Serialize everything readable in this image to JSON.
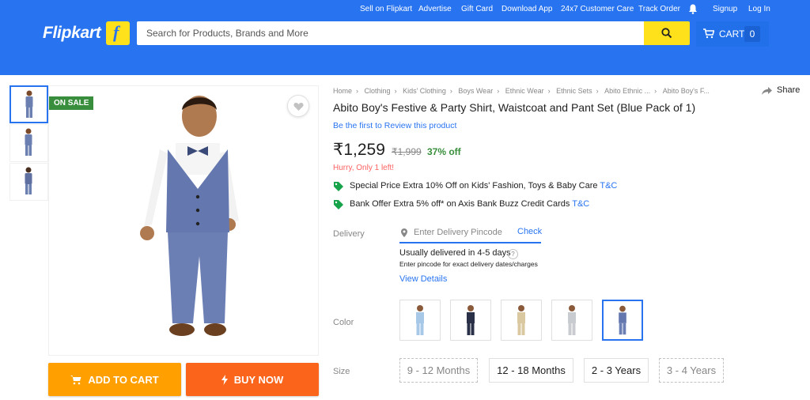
{
  "header": {
    "links": [
      "Sell on Flipkart",
      "Advertise",
      "Gift Card",
      "Download App",
      "24x7 Customer Care",
      "Track Order",
      "Signup",
      "Log In"
    ],
    "logo": "Flipkart",
    "search_placeholder": "Search for Products, Brands and More",
    "cart_label": "CART",
    "cart_count": "0",
    "accent": "#2874f0",
    "search_button_color": "#ffe11b"
  },
  "gallery": {
    "badge": "ON SALE",
    "thumbnails": 3,
    "active_thumbnail": 1
  },
  "actions": {
    "add_to_cart": "ADD TO CART",
    "buy_now": "BUY NOW",
    "add_to_cart_color": "#ff9f00",
    "buy_now_color": "#fb641b"
  },
  "product": {
    "breadcrumbs": [
      "Home",
      "Clothing",
      "Kids' Clothing",
      "Boys Wear",
      "Ethnic Wear",
      "Ethnic Sets",
      "Abito Ethnic ...",
      "Abito Boy's F..."
    ],
    "share": "Share",
    "title": "Abito Boy's Festive & Party Shirt, Waistcoat and Pant Set  (Blue Pack of 1)",
    "review_link": "Be the first to Review this product",
    "price": "₹1,259",
    "mrp": "₹1,999",
    "discount": "37% off",
    "stock_note": "Hurry, Only 1 left!",
    "offers": [
      {
        "text": "Special Price Extra 10% Off on Kids' Fashion, Toys & Baby Care",
        "tc": "T&C"
      },
      {
        "text": "Bank Offer Extra 5% off* on Axis Bank Buzz Credit Cards",
        "tc": "T&C"
      }
    ]
  },
  "delivery": {
    "label": "Delivery",
    "pincode_placeholder": "Enter Delivery Pincode",
    "check": "Check",
    "eta": "Usually delivered in 4-5 days",
    "note": "Enter pincode for exact delivery dates/charges",
    "view_details": "View Details",
    "help": "?"
  },
  "color": {
    "label": "Color",
    "swatches": [
      "light-blue",
      "navy",
      "beige",
      "grey",
      "blue"
    ],
    "selected": 4
  },
  "size": {
    "label": "Size",
    "options": [
      {
        "label": "9 - 12 Months",
        "available": false
      },
      {
        "label": "12 - 18 Months",
        "available": true
      },
      {
        "label": "2 - 3 Years",
        "available": true
      },
      {
        "label": "3 - 4 Years",
        "available": false
      }
    ]
  }
}
